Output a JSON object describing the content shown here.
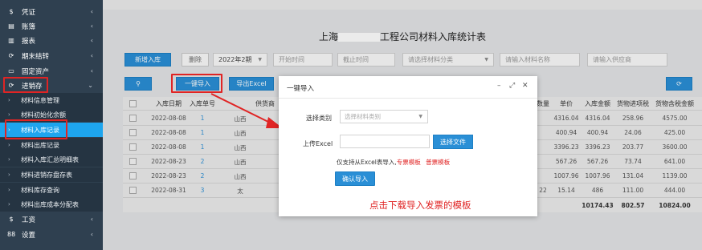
{
  "sidebar": {
    "items": [
      {
        "icon": "$",
        "icon_name": "dollar-icon",
        "label": "凭证"
      },
      {
        "icon": "▤",
        "icon_name": "ledger-icon",
        "label": "账簿"
      },
      {
        "icon": "▥",
        "icon_name": "report-icon",
        "label": "报表"
      },
      {
        "icon": "⟳",
        "icon_name": "period-close-icon",
        "label": "期末结转"
      },
      {
        "icon": "▭",
        "icon_name": "asset-icon",
        "label": "固定资产"
      },
      {
        "icon": "⟳",
        "icon_name": "inventory-icon",
        "label": "进销存"
      }
    ],
    "submenu": [
      "材料信息管理",
      "材料初始化余额",
      "材料入库记录",
      "材料出库记录",
      "材料入库汇总明细表",
      "材料进销存盘存表",
      "材料库存查询",
      "材料出库成本分配表"
    ],
    "bottom_items": [
      {
        "icon": "$",
        "icon_name": "wage-icon",
        "label": "工资"
      },
      {
        "icon": "88",
        "icon_name": "settings-grid-icon",
        "label": "设置"
      }
    ],
    "expanded_caret": "⌄",
    "collapsed_caret": "‹"
  },
  "page": {
    "title_prefix": "上海",
    "title_suffix": "工程公司材料入库统计表"
  },
  "toolbar": {
    "add_label": "新增入库",
    "delete_label": "删除",
    "period_value": "2022年2期",
    "start_placeholder": "开始时间",
    "end_placeholder": "截止时间",
    "category_placeholder": "请选择材料分类",
    "name_placeholder": "请输入材料名称",
    "supplier_placeholder": "请输入供应商",
    "import_label": "一键导入",
    "export_label": "导出Excel"
  },
  "table": {
    "headers": [
      "入库日期",
      "入库单号",
      "供货商",
      "数量",
      "单价",
      "入库金额",
      "货物进项税",
      "货物含税金额"
    ],
    "rows": [
      {
        "date": "2022-08-08",
        "no": "1",
        "supplier": "山西",
        "qty": "",
        "price": "4316.04",
        "amount": "4316.04",
        "tax": "258.96",
        "total": "4575.00"
      },
      {
        "date": "2022-08-08",
        "no": "1",
        "supplier": "山西",
        "qty": "",
        "price": "400.94",
        "amount": "400.94",
        "tax": "24.06",
        "total": "425.00"
      },
      {
        "date": "2022-08-08",
        "no": "1",
        "supplier": "山西",
        "qty": "",
        "price": "3396.23",
        "amount": "3396.23",
        "tax": "203.77",
        "total": "3600.00"
      },
      {
        "date": "2022-08-23",
        "no": "2",
        "supplier": "山西",
        "qty": "",
        "price": "567.26",
        "amount": "567.26",
        "tax": "73.74",
        "total": "641.00"
      },
      {
        "date": "2022-08-23",
        "no": "2",
        "supplier": "山西",
        "qty": "",
        "price": "1007.96",
        "amount": "1007.96",
        "tax": "131.04",
        "total": "1139.00"
      },
      {
        "date": "2022-08-31",
        "no": "3",
        "supplier": "太",
        "qty": "22",
        "price": "15.14",
        "amount": "486",
        "tax": "111.00",
        "total": "444.00"
      }
    ],
    "totals": {
      "amount": "10174.43",
      "tax": "802.57",
      "total": "10824.00"
    }
  },
  "modal": {
    "title": "一键导入",
    "category_label": "选择类别",
    "category_placeholder": "选择材料类别",
    "upload_label": "上传Excel",
    "choose_file_label": "选择文件",
    "note_prefix": "仅支持从Excel表导入,",
    "special_template": "专票模板",
    "normal_template": "普票模板",
    "confirm_label": "确认导入"
  },
  "annotation": {
    "hint": "点击下载导入发票的模板"
  },
  "colors": {
    "sidebar_bg": "#2f4050",
    "active_blue": "#1ea5ee",
    "primary_blue": "#2a8fd6",
    "annotation_red": "#e02424"
  }
}
